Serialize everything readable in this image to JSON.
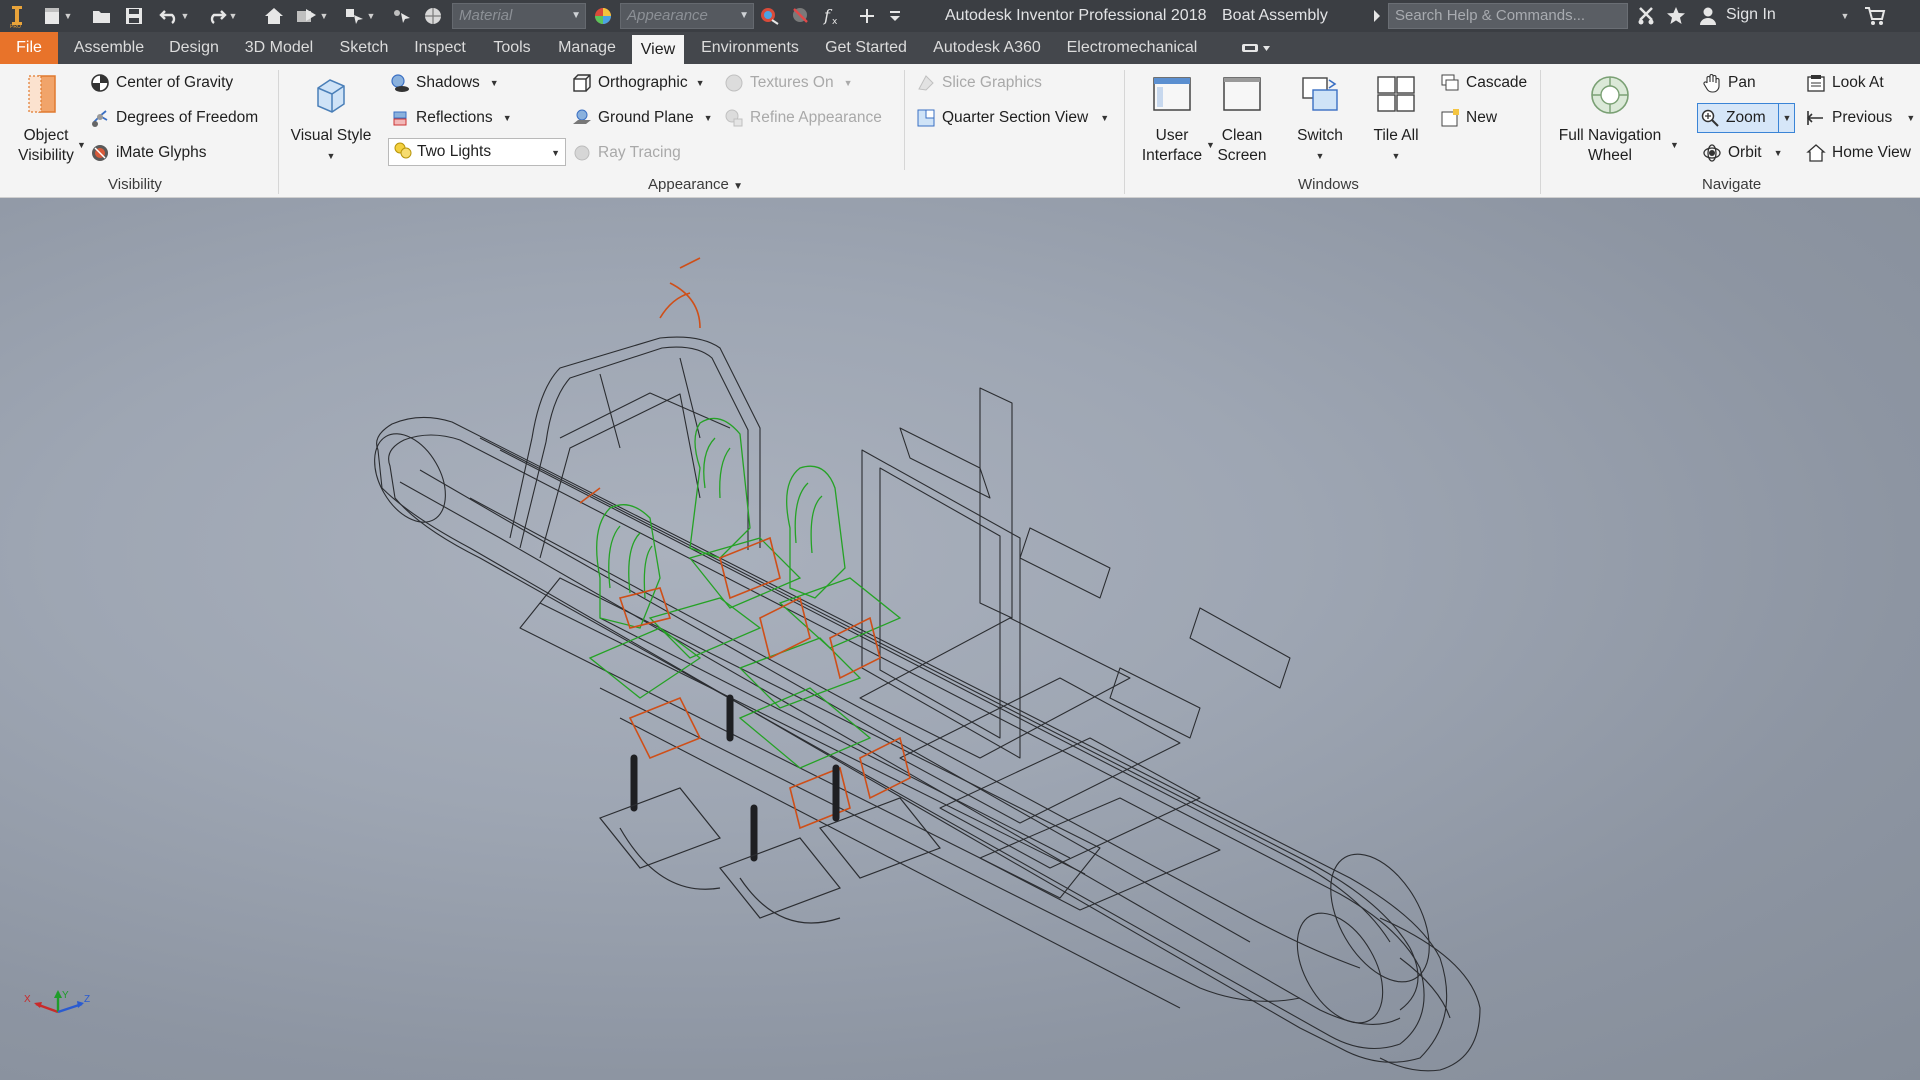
{
  "titlebar": {
    "app_title": "Autodesk Inventor Professional 2018",
    "document_title": "Boat Assembly",
    "material_placeholder": "Material",
    "appearance_placeholder": "Appearance",
    "search_placeholder": "Search Help & Commands...",
    "sign_in": "Sign In"
  },
  "tabs": [
    {
      "label": "File"
    },
    {
      "label": "Assemble"
    },
    {
      "label": "Design"
    },
    {
      "label": "3D Model"
    },
    {
      "label": "Sketch"
    },
    {
      "label": "Inspect"
    },
    {
      "label": "Tools"
    },
    {
      "label": "Manage"
    },
    {
      "label": "View"
    },
    {
      "label": "Environments"
    },
    {
      "label": "Get Started"
    },
    {
      "label": "Autodesk A360"
    },
    {
      "label": "Electromechanical"
    }
  ],
  "active_tab": "View",
  "ribbon": {
    "visibility": {
      "panel_label": "Visibility",
      "object_visibility": "Object Visibility",
      "object_visibility_l1": "Object",
      "object_visibility_l2": "Visibility",
      "center_of_gravity": "Center of Gravity",
      "degrees_of_freedom": "Degrees of Freedom",
      "imate_glyphs": "iMate Glyphs"
    },
    "appearance": {
      "panel_label": "Appearance",
      "visual_style": "Visual Style",
      "shadows": "Shadows",
      "reflections": "Reflections",
      "lighting": "Two Lights",
      "orthographic": "Orthographic",
      "ground_plane": "Ground Plane",
      "ray_tracing": "Ray Tracing",
      "textures_on": "Textures On",
      "refine_appearance": "Refine Appearance",
      "slice_graphics": "Slice Graphics",
      "quarter_section_view": "Quarter Section View"
    },
    "windows": {
      "panel_label": "Windows",
      "user_interface_l1": "User",
      "user_interface_l2": "Interface",
      "clean_screen_l1": "Clean",
      "clean_screen_l2": "Screen",
      "switch": "Switch",
      "tile_all": "Tile All",
      "cascade": "Cascade",
      "new": "New"
    },
    "navigate": {
      "panel_label": "Navigate",
      "full_nav_l1": "Full Navigation",
      "full_nav_l2": "Wheel",
      "pan": "Pan",
      "zoom": "Zoom",
      "orbit": "Orbit",
      "look_at": "Look At",
      "previous": "Previous",
      "home_view": "Home View"
    }
  },
  "triad": {
    "x": "X",
    "y": "Y",
    "z": "Z"
  },
  "colors": {
    "accent_file": "#e8732a",
    "seat_green": "#1fa51f",
    "seat_orange": "#d2521a",
    "wire_dark": "#2a2c30"
  }
}
